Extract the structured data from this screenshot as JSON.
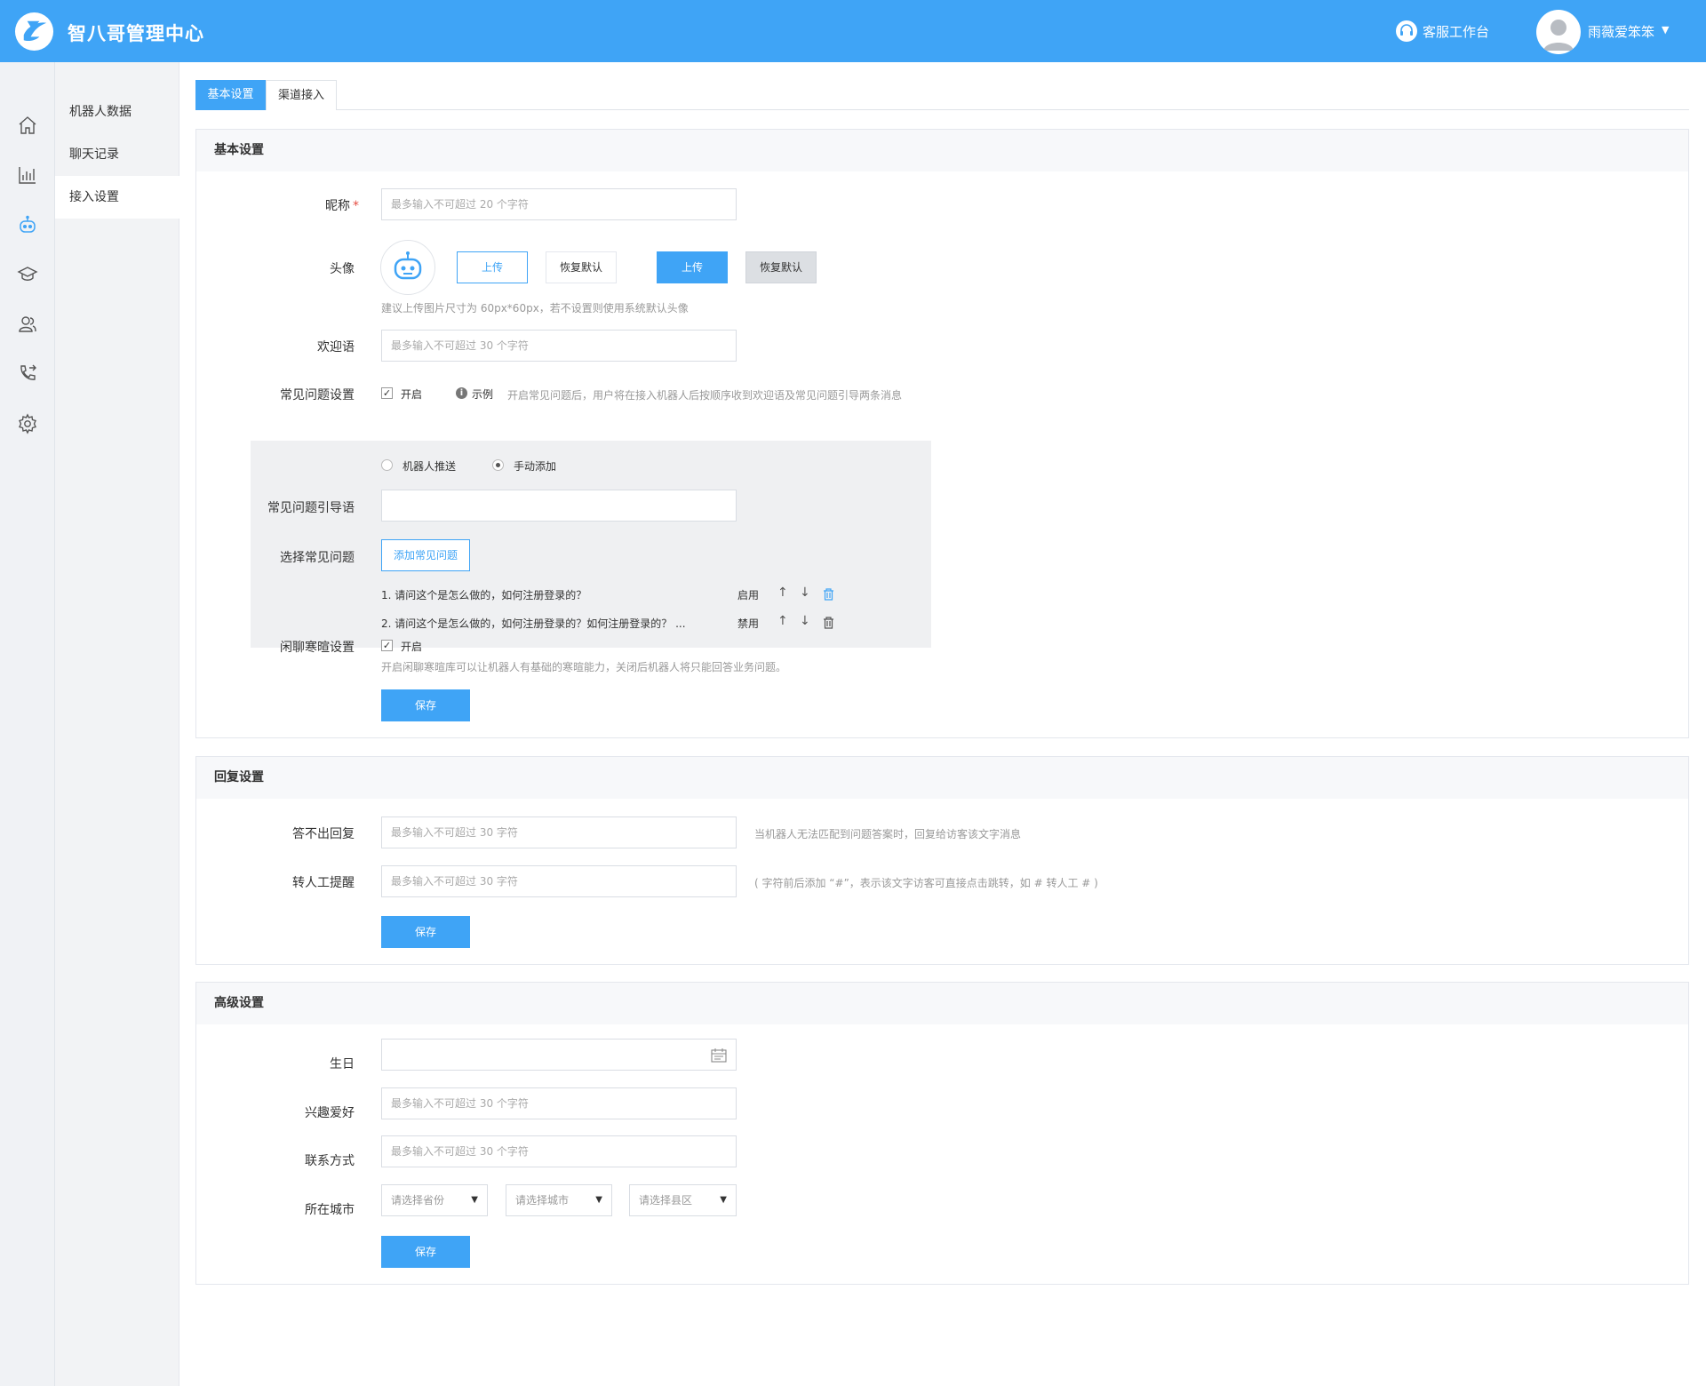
{
  "header": {
    "brand": "智八哥管理中心",
    "workspace_label": "客服工作台",
    "username": "雨薇爱笨笨"
  },
  "submenu": {
    "items": [
      {
        "label": "机器人数据"
      },
      {
        "label": "聊天记录"
      },
      {
        "label": "接入设置"
      }
    ]
  },
  "tabs": [
    {
      "label": "基本设置",
      "active": true
    },
    {
      "label": "渠道接入",
      "active": false
    }
  ],
  "basic": {
    "title": "基本设置",
    "nickname_label": "昵称",
    "nickname_placeholder": "最多输入不可超过 20 个字符",
    "avatar_label": "头像",
    "upload_label": "上传",
    "reset_label": "恢复默认",
    "upload_label_2": "上传",
    "reset_label_2": "恢复默认",
    "avatar_hint": "建议上传图片尺寸为 60px*60px，若不设置则使用系统默认头像",
    "welcome_label": "欢迎语",
    "welcome_placeholder": "最多输入不可超过 30 个字符",
    "faq_label": "常见问题设置",
    "faq_enable": "开启",
    "faq_example": "示例",
    "faq_hint": "开启常见问题后，用户将在接入机器人后按顺序收到欢迎语及常见问题引导两条消息",
    "radio_robot": "机器人推送",
    "radio_manual": "手动添加",
    "guide_label": "常见问题引导语",
    "select_faq_label": "选择常见问题",
    "add_faq_button": "添加常见问题",
    "faq_items": [
      {
        "text": "1. 请问这个是怎么做的，如何注册登录的？",
        "status": "启用"
      },
      {
        "text": "2. 请问这个是怎么做的，如何注册登录的？如何注册登录的？ ...",
        "status": "禁用"
      }
    ],
    "chat_label": "闲聊寒暄设置",
    "chat_enable": "开启",
    "chat_hint": "开启闲聊寒暄库可以让机器人有基础的寒暄能力，关闭后机器人将只能回答业务问题。",
    "save_label": "保存"
  },
  "reply": {
    "title": "回复设置",
    "no_answer_label": "答不出回复",
    "no_answer_placeholder": "最多输入不可超过 30 字符",
    "no_answer_hint": "当机器人无法匹配到问题答案时，回复给访客该文字消息",
    "transfer_label": "转人工提醒",
    "transfer_placeholder": "最多输入不可超过 30 字符",
    "transfer_hint": "( 字符前后添加 “#”，表示该文字访客可直接点击跳转，如 # 转人工 # )",
    "save_label": "保存"
  },
  "advanced": {
    "title": "高级设置",
    "birthday_label": "生日",
    "hobby_label": "兴趣爱好",
    "hobby_placeholder": "最多输入不可超过 30 个字符",
    "contact_label": "联系方式",
    "contact_placeholder": "最多输入不可超过 30 个字符",
    "city_label": "所在城市",
    "province_placeholder": "请选择省份",
    "city_placeholder": "请选择城市",
    "district_placeholder": "请选择县区",
    "save_label": "保存"
  },
  "colors": {
    "primary": "#3fa4f6",
    "required": "#e54d42"
  }
}
